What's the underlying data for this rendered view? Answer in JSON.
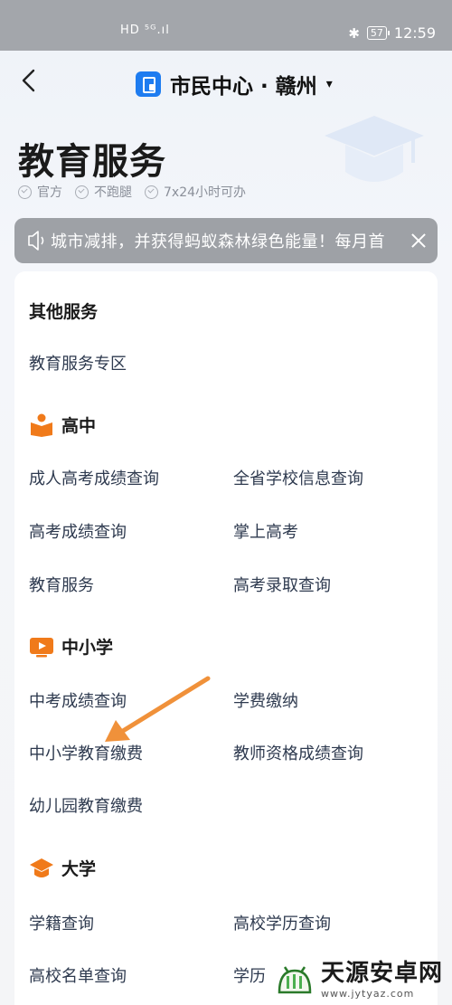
{
  "status_bar": {
    "left_icons": "HD ⁵ᴳ.ıl",
    "battery": "57",
    "time": "12:59"
  },
  "nav": {
    "title": "市民中心 · 赣州",
    "caret": "▾"
  },
  "hero": {
    "title": "教育服务",
    "badges": [
      "官方",
      "不跑腿",
      "7x24小时可办"
    ]
  },
  "notice": {
    "text": "城市减排，并获得蚂蚁森林绿色能量！每月首"
  },
  "sections": {
    "other": {
      "title": "其他服务",
      "items": [
        "教育服务专区"
      ]
    },
    "high": {
      "title": "高中",
      "items": [
        "成人高考成绩查询",
        "全省学校信息查询",
        "高考成绩查询",
        "掌上高考",
        "教育服务",
        "高考录取查询"
      ]
    },
    "primary": {
      "title": "中小学",
      "items": [
        "中考成绩查询",
        "学费缴纳",
        "中小学教育缴费",
        "教师资格成绩查询",
        "幼儿园教育缴费"
      ]
    },
    "university": {
      "title": "大学",
      "items": [
        "学籍查询",
        "高校学历查询",
        "高校名单查询",
        "学历"
      ]
    }
  },
  "watermark": {
    "name": "天源安卓网",
    "url": "www.jytyaz.com"
  },
  "colors": {
    "accent_orange": "#f07a1a",
    "brand_blue": "#1e7cf0",
    "arrow": "#f0913a"
  }
}
